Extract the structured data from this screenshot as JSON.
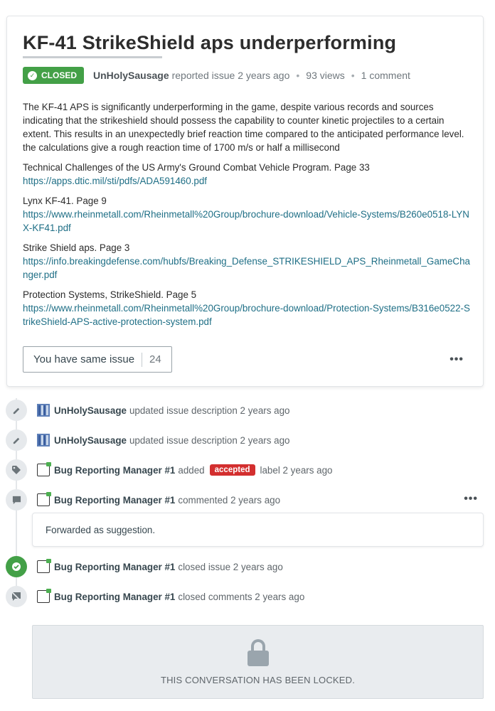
{
  "issue": {
    "title": "KF-41 StrikeShield aps underperforming",
    "status": "CLOSED",
    "author": "UnHolySausage",
    "reported_text": "reported issue 2 years ago",
    "views": "93 views",
    "comments": "1 comment",
    "description": "The KF-41 APS is significantly underperforming in the game, despite various records and sources indicating that the strikeshield should possess the capability to counter kinetic projectiles to a certain extent. This results in an unexpectedly brief reaction time compared to the anticipated performance level. the calculations give a rough reaction time of 1700 m/s or half a millisecond",
    "sources": [
      {
        "label": "Technical Challenges of the US Army's Ground Combat Vehicle Program. Page 33",
        "url": "https://apps.dtic.mil/sti/pdfs/ADA591460.pdf"
      },
      {
        "label": "Lynx KF-41. Page 9",
        "url": "https://www.rheinmetall.com/Rheinmetall%20Group/brochure-download/Vehicle-Systems/B260e0518-LYNX-KF41.pdf"
      },
      {
        "label": "Strike Shield aps. Page 3",
        "url": "https://info.breakingdefense.com/hubfs/Breaking_Defense_STRIKESHIELD_APS_Rheinmetall_GameChanger.pdf"
      },
      {
        "label": "Protection Systems, StrikeShield. Page 5",
        "url": "https://www.rheinmetall.com/Rheinmetall%20Group/brochure-download/Protection-Systems/B316e0522-StrikeShield-APS-active-protection-system.pdf"
      }
    ],
    "same_issue_label": "You have same issue",
    "same_issue_count": "24",
    "more_icon": "more-horizontal-icon"
  },
  "timeline": [
    {
      "icon": "pencil-icon",
      "user": "UnHolySausage",
      "text": "updated issue description 2 years ago"
    },
    {
      "icon": "pencil-icon",
      "user": "UnHolySausage",
      "text": "updated issue description 2 years ago"
    },
    {
      "icon": "tag-icon",
      "user": "Bug Reporting Manager #1",
      "pre": "added",
      "label": "accepted",
      "post": "label 2 years ago"
    },
    {
      "icon": "comment-icon",
      "user": "Bug Reporting Manager #1",
      "text": "commented 2 years ago"
    },
    {
      "icon": "check-circle-icon",
      "user": "Bug Reporting Manager #1",
      "text": "closed issue 2 years ago"
    },
    {
      "icon": "comment-off-icon",
      "user": "Bug Reporting Manager #1",
      "text": "closed comments 2 years ago"
    }
  ],
  "comment": {
    "text": "Forwarded as suggestion."
  },
  "locked": {
    "text": "THIS CONVERSATION HAS BEEN LOCKED."
  },
  "colors": {
    "closed_badge": "#43a047",
    "accepted_label": "#d32f2f",
    "link": "#1f6f86"
  }
}
